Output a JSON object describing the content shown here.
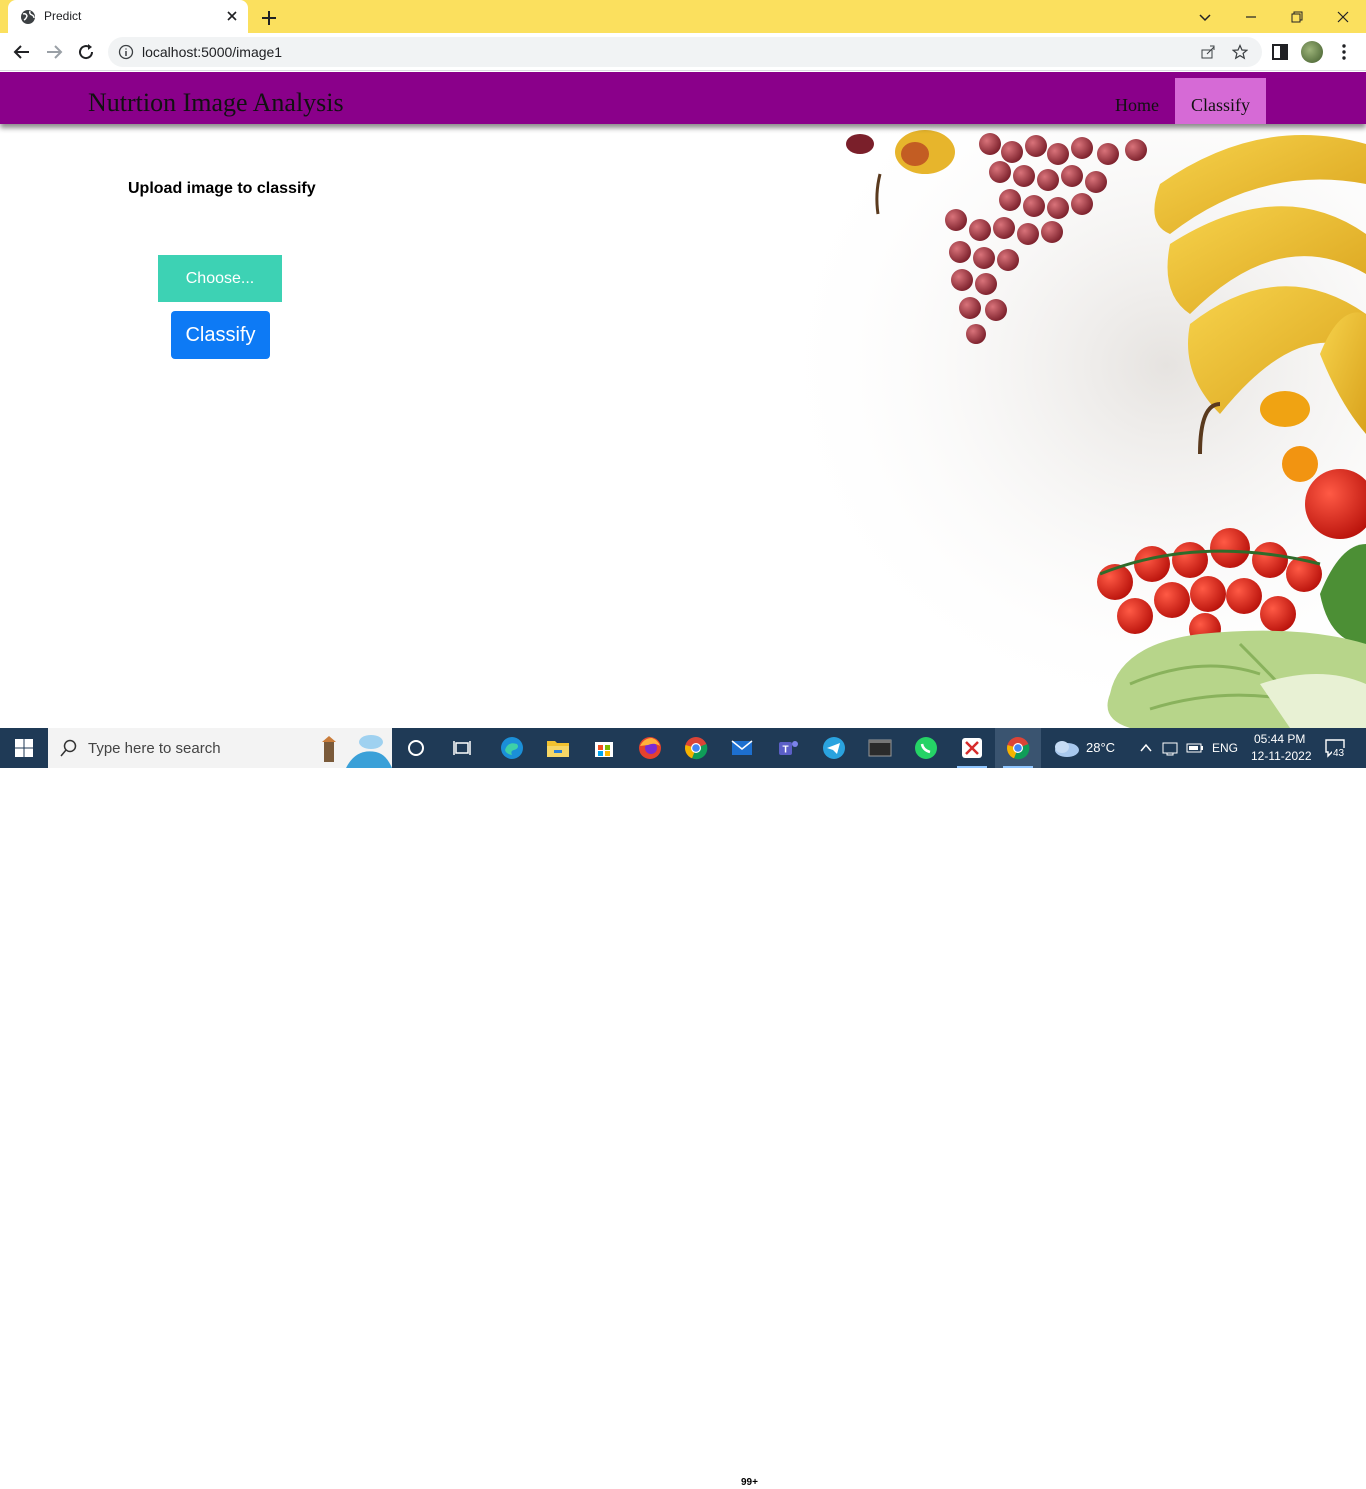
{
  "browser": {
    "tab_title": "Predict",
    "url": "localhost:5000/image1",
    "accent_color": "#fbe05e"
  },
  "site": {
    "brand": "Nutrtion Image Analysis",
    "nav": {
      "home": "Home",
      "classify": "Classify"
    },
    "navbar_color": "#8a008a",
    "active_nav_color": "#d66ad6"
  },
  "upload": {
    "label": "Upload image to classify",
    "choose_label": "Choose...",
    "classify_label": "Classify",
    "choose_color": "#3dd2b4",
    "classify_color": "#0d7af5"
  },
  "taskbar": {
    "search_placeholder": "Type here to search",
    "mail_badge": "99+",
    "weather": "28°C",
    "language": "ENG",
    "time": "05:44 PM",
    "date": "12-11-2022",
    "notifications": "43"
  }
}
